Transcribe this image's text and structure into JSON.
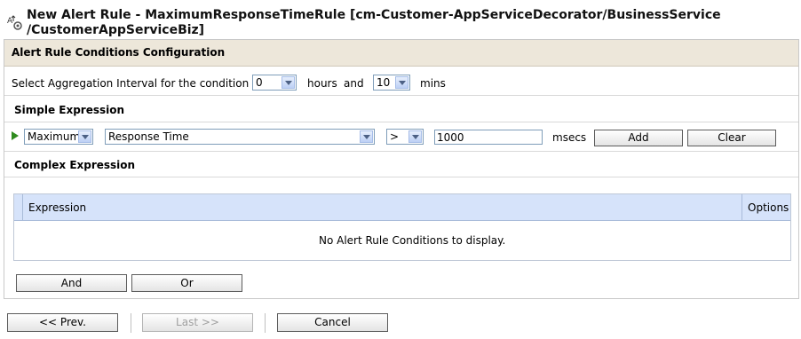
{
  "title": "New Alert Rule - MaximumResponseTimeRule [cm-Customer-AppServiceDecorator/BusinessService /CustomerAppServiceBiz]",
  "section_title": "Alert Rule Conditions Configuration",
  "aggregation": {
    "label": "Select Aggregation Interval for the condition :",
    "hours_value": "0",
    "hours_label": "hours",
    "and_label": "and",
    "mins_value": "10",
    "mins_label": "mins"
  },
  "simple_expression": {
    "heading": "Simple Expression",
    "function_value": "Maximum",
    "metric_value": "Response Time",
    "operator_value": ">",
    "threshold_value": "1000",
    "unit_label": "msecs",
    "add_label": "Add",
    "clear_label": "Clear"
  },
  "complex_expression": {
    "heading": "Complex Expression",
    "columns": [
      "Expression",
      "Options"
    ],
    "empty_message": "No Alert Rule Conditions to display.",
    "and_label": "And",
    "or_label": "Or"
  },
  "footer": {
    "prev_label": "<< Prev.",
    "last_label": "Last >>",
    "cancel_label": "Cancel"
  },
  "colors": {
    "section_header_bg": "#ede7da",
    "grid_header_bg": "#d6e3fa",
    "play_icon": "#2e8b1e"
  }
}
